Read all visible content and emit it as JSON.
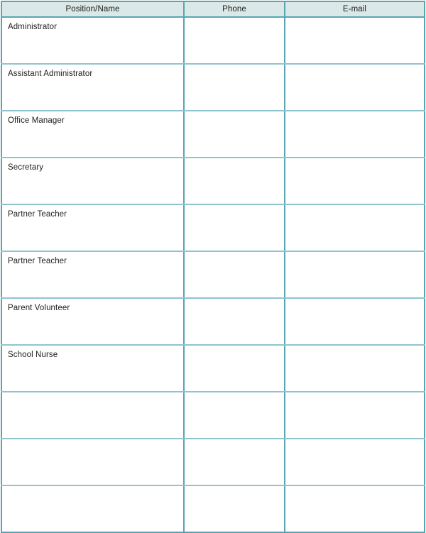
{
  "document": {
    "title": "Contact Information Table",
    "colors": {
      "header_fill": "#dae8e7",
      "border_strong": "#58a5b2",
      "border_light": "#8fc4cf",
      "text": "#1d1d1b",
      "page_background": "#ffffff"
    }
  },
  "table": {
    "columns": [
      {
        "key": "position",
        "label": "Position/Name",
        "align": "center"
      },
      {
        "key": "phone",
        "label": "Phone",
        "align": "center"
      },
      {
        "key": "email",
        "label": "E-mail",
        "align": "center"
      }
    ],
    "rows": [
      {
        "position": "Administrator",
        "phone": "",
        "email": ""
      },
      {
        "position": "Assistant Administrator",
        "phone": "",
        "email": ""
      },
      {
        "position": "Office Manager",
        "phone": "",
        "email": ""
      },
      {
        "position": "Secretary",
        "phone": "",
        "email": ""
      },
      {
        "position": "Partner Teacher",
        "phone": "",
        "email": ""
      },
      {
        "position": "Partner Teacher",
        "phone": "",
        "email": ""
      },
      {
        "position": "Parent Volunteer",
        "phone": "",
        "email": ""
      },
      {
        "position": "School Nurse",
        "phone": "",
        "email": ""
      },
      {
        "position": "",
        "phone": "",
        "email": ""
      },
      {
        "position": "",
        "phone": "",
        "email": ""
      },
      {
        "position": "",
        "phone": "",
        "email": ""
      }
    ]
  }
}
